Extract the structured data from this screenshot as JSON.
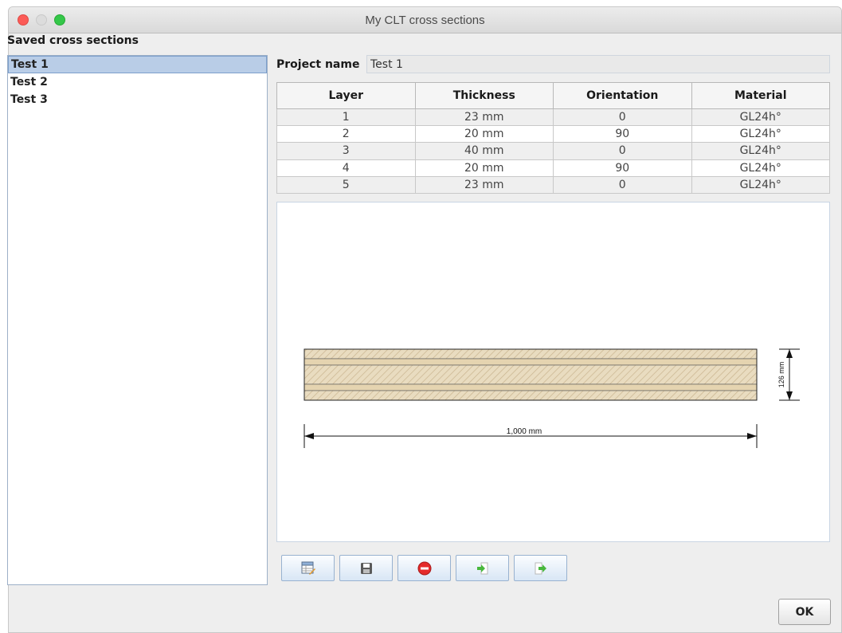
{
  "window": {
    "title": "My CLT cross sections"
  },
  "saved": {
    "label": "Saved cross sections",
    "items": [
      {
        "label": "Test 1",
        "selected": true
      },
      {
        "label": "Test 2",
        "selected": false
      },
      {
        "label": "Test 3",
        "selected": false
      }
    ]
  },
  "project": {
    "label": "Project name",
    "value": "Test 1"
  },
  "table": {
    "headers": [
      "Layer",
      "Thickness",
      "Orientation",
      "Material"
    ],
    "rows": [
      [
        "1",
        "23 mm",
        "0",
        "GL24h°"
      ],
      [
        "2",
        "20 mm",
        "90",
        "GL24h°"
      ],
      [
        "3",
        "40 mm",
        "0",
        "GL24h°"
      ],
      [
        "4",
        "20 mm",
        "90",
        "GL24h°"
      ],
      [
        "5",
        "23 mm",
        "0",
        "GL24h°"
      ]
    ]
  },
  "drawing": {
    "width_label": "1,000 mm",
    "height_label": "126 mm"
  },
  "toolbar": {
    "buttons": [
      {
        "icon": "edit-table-icon"
      },
      {
        "icon": "save-disk-icon"
      },
      {
        "icon": "delete-stop-icon"
      },
      {
        "icon": "import-arrow-icon"
      },
      {
        "icon": "export-arrow-icon"
      }
    ]
  },
  "footer": {
    "ok_label": "OK"
  },
  "colors": {
    "selection": "#b9cde7",
    "wood_light": "#e9dcc0",
    "wood_dark": "#c9b48f",
    "delete_red": "#e52b2b",
    "arrow_green": "#48b83c"
  }
}
